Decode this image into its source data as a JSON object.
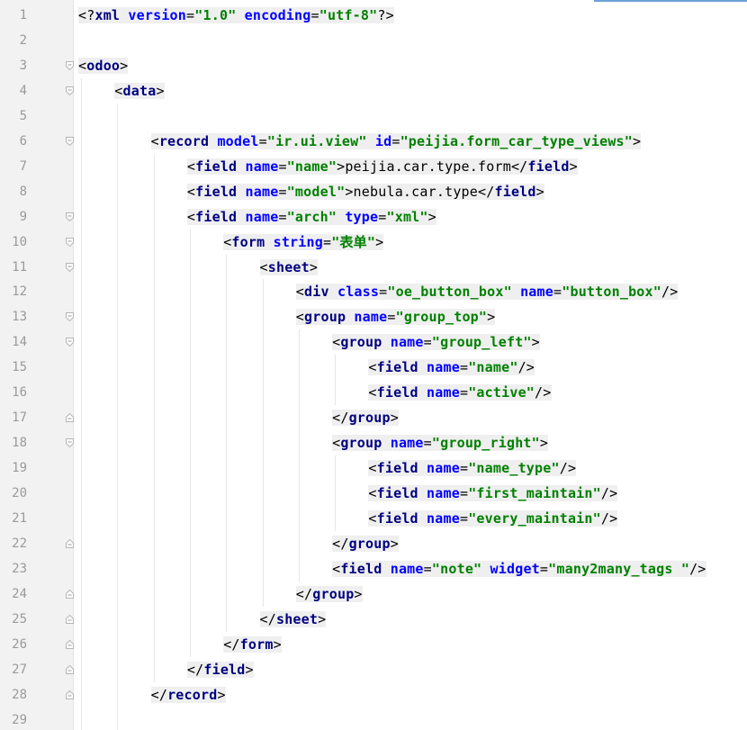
{
  "editor": {
    "lines": [
      {
        "n": "1",
        "indent": 0,
        "fold": "",
        "parts": [
          [
            "punc",
            "<?"
          ],
          [
            "tag",
            "xml"
          ],
          [
            "punc",
            " "
          ],
          [
            "attr",
            "version"
          ],
          [
            "punc",
            "="
          ],
          [
            "val",
            "\"1.0\""
          ],
          [
            "punc",
            " "
          ],
          [
            "attr",
            "encoding"
          ],
          [
            "punc",
            "="
          ],
          [
            "val",
            "\"utf-8\""
          ],
          [
            "punc",
            "?>"
          ]
        ]
      },
      {
        "n": "2",
        "indent": 0,
        "fold": "",
        "parts": []
      },
      {
        "n": "3",
        "indent": 0,
        "fold": "open",
        "parts": [
          [
            "punc",
            "<"
          ],
          [
            "tag",
            "odoo"
          ],
          [
            "punc",
            ">"
          ]
        ]
      },
      {
        "n": "4",
        "indent": 1,
        "fold": "open",
        "parts": [
          [
            "punc",
            "<"
          ],
          [
            "tag",
            "data"
          ],
          [
            "punc",
            ">"
          ]
        ]
      },
      {
        "n": "5",
        "indent": 0,
        "fold": "",
        "parts": []
      },
      {
        "n": "6",
        "indent": 2,
        "fold": "open",
        "parts": [
          [
            "punc",
            "<"
          ],
          [
            "tag",
            "record"
          ],
          [
            "punc",
            " "
          ],
          [
            "attr",
            "model"
          ],
          [
            "punc",
            "="
          ],
          [
            "val",
            "\"ir.ui.view\""
          ],
          [
            "punc",
            " "
          ],
          [
            "attr",
            "id"
          ],
          [
            "punc",
            "="
          ],
          [
            "val",
            "\"peijia.form_car_type_views\""
          ],
          [
            "punc",
            ">"
          ]
        ]
      },
      {
        "n": "7",
        "indent": 3,
        "fold": "",
        "parts": [
          [
            "punc",
            "<"
          ],
          [
            "tag",
            "field"
          ],
          [
            "punc",
            " "
          ],
          [
            "attr",
            "name"
          ],
          [
            "punc",
            "="
          ],
          [
            "val",
            "\"name\""
          ],
          [
            "punc",
            ">"
          ],
          [
            "text",
            "peijia.car.type.form"
          ],
          [
            "punc",
            "</"
          ],
          [
            "tag",
            "field"
          ],
          [
            "punc",
            ">"
          ]
        ]
      },
      {
        "n": "8",
        "indent": 3,
        "fold": "",
        "parts": [
          [
            "punc",
            "<"
          ],
          [
            "tag",
            "field"
          ],
          [
            "punc",
            " "
          ],
          [
            "attr",
            "name"
          ],
          [
            "punc",
            "="
          ],
          [
            "val",
            "\"model\""
          ],
          [
            "punc",
            ">"
          ],
          [
            "text",
            "nebula.car.type"
          ],
          [
            "punc",
            "</"
          ],
          [
            "tag",
            "field"
          ],
          [
            "punc",
            ">"
          ]
        ]
      },
      {
        "n": "9",
        "indent": 3,
        "fold": "open",
        "parts": [
          [
            "punc",
            "<"
          ],
          [
            "tag",
            "field"
          ],
          [
            "punc",
            " "
          ],
          [
            "attr",
            "name"
          ],
          [
            "punc",
            "="
          ],
          [
            "val",
            "\"arch\""
          ],
          [
            "punc",
            " "
          ],
          [
            "attr",
            "type"
          ],
          [
            "punc",
            "="
          ],
          [
            "val",
            "\"xml\""
          ],
          [
            "punc",
            ">"
          ]
        ]
      },
      {
        "n": "10",
        "indent": 4,
        "fold": "open",
        "parts": [
          [
            "punc",
            "<"
          ],
          [
            "tag",
            "form"
          ],
          [
            "punc",
            " "
          ],
          [
            "attr",
            "string"
          ],
          [
            "punc",
            "="
          ],
          [
            "val",
            "\"表单\""
          ],
          [
            "punc",
            ">"
          ]
        ]
      },
      {
        "n": "11",
        "indent": 5,
        "fold": "open",
        "parts": [
          [
            "punc",
            "<"
          ],
          [
            "tag",
            "sheet"
          ],
          [
            "punc",
            ">"
          ]
        ]
      },
      {
        "n": "12",
        "indent": 6,
        "fold": "",
        "parts": [
          [
            "punc",
            "<"
          ],
          [
            "tag",
            "div"
          ],
          [
            "punc",
            " "
          ],
          [
            "attr",
            "class"
          ],
          [
            "punc",
            "="
          ],
          [
            "val",
            "\"oe_button_box\""
          ],
          [
            "punc",
            " "
          ],
          [
            "attr",
            "name"
          ],
          [
            "punc",
            "="
          ],
          [
            "val",
            "\"button_box\""
          ],
          [
            "punc",
            "/>"
          ]
        ]
      },
      {
        "n": "13",
        "indent": 6,
        "fold": "open",
        "parts": [
          [
            "punc",
            "<"
          ],
          [
            "tag",
            "group"
          ],
          [
            "punc",
            " "
          ],
          [
            "attr",
            "name"
          ],
          [
            "punc",
            "="
          ],
          [
            "val",
            "\"group_top\""
          ],
          [
            "punc",
            ">"
          ]
        ]
      },
      {
        "n": "14",
        "indent": 7,
        "fold": "open",
        "parts": [
          [
            "punc",
            "<"
          ],
          [
            "tag",
            "group"
          ],
          [
            "punc",
            " "
          ],
          [
            "attr",
            "name"
          ],
          [
            "punc",
            "="
          ],
          [
            "val",
            "\"group_left\""
          ],
          [
            "punc",
            ">"
          ]
        ]
      },
      {
        "n": "15",
        "indent": 8,
        "fold": "",
        "parts": [
          [
            "punc",
            "<"
          ],
          [
            "tag",
            "field"
          ],
          [
            "punc",
            " "
          ],
          [
            "attr",
            "name"
          ],
          [
            "punc",
            "="
          ],
          [
            "val",
            "\"name\""
          ],
          [
            "punc",
            "/>"
          ]
        ]
      },
      {
        "n": "16",
        "indent": 8,
        "fold": "",
        "parts": [
          [
            "punc",
            "<"
          ],
          [
            "tag",
            "field"
          ],
          [
            "punc",
            " "
          ],
          [
            "attr",
            "name"
          ],
          [
            "punc",
            "="
          ],
          [
            "val",
            "\"active\""
          ],
          [
            "punc",
            "/>"
          ]
        ]
      },
      {
        "n": "17",
        "indent": 7,
        "fold": "close",
        "parts": [
          [
            "punc",
            "</"
          ],
          [
            "tag",
            "group"
          ],
          [
            "punc",
            ">"
          ]
        ]
      },
      {
        "n": "18",
        "indent": 7,
        "fold": "open",
        "parts": [
          [
            "punc",
            "<"
          ],
          [
            "tag",
            "group"
          ],
          [
            "punc",
            " "
          ],
          [
            "attr",
            "name"
          ],
          [
            "punc",
            "="
          ],
          [
            "val",
            "\"group_right\""
          ],
          [
            "punc",
            ">"
          ]
        ]
      },
      {
        "n": "19",
        "indent": 8,
        "fold": "",
        "parts": [
          [
            "punc",
            "<"
          ],
          [
            "tag",
            "field"
          ],
          [
            "punc",
            " "
          ],
          [
            "attr",
            "name"
          ],
          [
            "punc",
            "="
          ],
          [
            "val",
            "\"name_type\""
          ],
          [
            "punc",
            "/>"
          ]
        ]
      },
      {
        "n": "20",
        "indent": 8,
        "fold": "",
        "parts": [
          [
            "punc",
            "<"
          ],
          [
            "tag",
            "field"
          ],
          [
            "punc",
            " "
          ],
          [
            "attr",
            "name"
          ],
          [
            "punc",
            "="
          ],
          [
            "val",
            "\"first_maintain\""
          ],
          [
            "punc",
            "/>"
          ]
        ]
      },
      {
        "n": "21",
        "indent": 8,
        "fold": "",
        "parts": [
          [
            "punc",
            "<"
          ],
          [
            "tag",
            "field"
          ],
          [
            "punc",
            " "
          ],
          [
            "attr",
            "name"
          ],
          [
            "punc",
            "="
          ],
          [
            "val",
            "\"every_maintain\""
          ],
          [
            "punc",
            "/>"
          ]
        ]
      },
      {
        "n": "22",
        "indent": 7,
        "fold": "close",
        "parts": [
          [
            "punc",
            "</"
          ],
          [
            "tag",
            "group"
          ],
          [
            "punc",
            ">"
          ]
        ]
      },
      {
        "n": "23",
        "indent": 7,
        "fold": "",
        "parts": [
          [
            "punc",
            "<"
          ],
          [
            "tag",
            "field"
          ],
          [
            "punc",
            " "
          ],
          [
            "attr",
            "name"
          ],
          [
            "punc",
            "="
          ],
          [
            "val",
            "\"note\""
          ],
          [
            "punc",
            " "
          ],
          [
            "attr",
            "widget"
          ],
          [
            "punc",
            "="
          ],
          [
            "val",
            "\"many2many_tags \""
          ],
          [
            "punc",
            "/>"
          ]
        ]
      },
      {
        "n": "24",
        "indent": 6,
        "fold": "close",
        "parts": [
          [
            "punc",
            "</"
          ],
          [
            "tag",
            "group"
          ],
          [
            "punc",
            ">"
          ]
        ]
      },
      {
        "n": "25",
        "indent": 5,
        "fold": "close",
        "parts": [
          [
            "punc",
            "</"
          ],
          [
            "tag",
            "sheet"
          ],
          [
            "punc",
            ">"
          ]
        ]
      },
      {
        "n": "26",
        "indent": 4,
        "fold": "close",
        "parts": [
          [
            "punc",
            "</"
          ],
          [
            "tag",
            "form"
          ],
          [
            "punc",
            ">"
          ]
        ]
      },
      {
        "n": "27",
        "indent": 3,
        "fold": "close",
        "parts": [
          [
            "punc",
            "</"
          ],
          [
            "tag",
            "field"
          ],
          [
            "punc",
            ">"
          ]
        ]
      },
      {
        "n": "28",
        "indent": 2,
        "fold": "close",
        "parts": [
          [
            "punc",
            "</"
          ],
          [
            "tag",
            "record"
          ],
          [
            "punc",
            ">"
          ]
        ]
      },
      {
        "n": "29",
        "indent": 0,
        "fold": "",
        "parts": []
      }
    ]
  },
  "colors": {
    "tag": "#000080",
    "attribute": "#0000ff",
    "value": "#008000",
    "line_number": "#9a9a9a",
    "gutter": "#f2f2f2",
    "line_highlight": "#efefef"
  }
}
